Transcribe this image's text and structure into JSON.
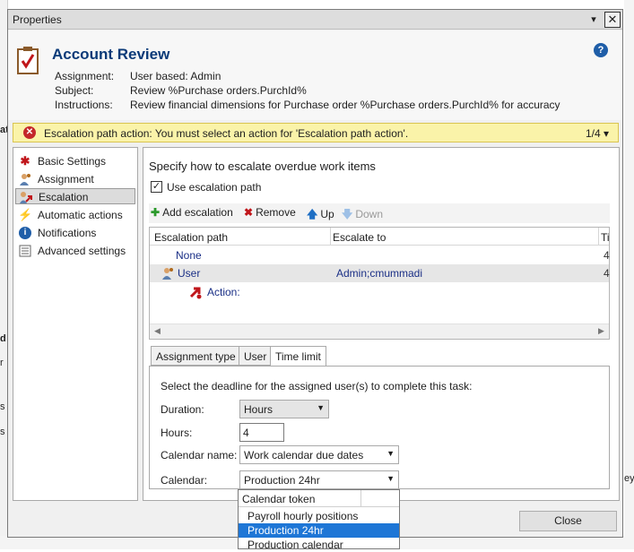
{
  "background": {
    "fragments": [
      "at",
      "d",
      "r",
      "s",
      "s",
      "ey"
    ]
  },
  "dialog": {
    "window_title": "Properties",
    "minimize_glyph": "▾",
    "close_glyph": "✕",
    "heading": "Account Review",
    "help_glyph": "?",
    "meta": [
      {
        "label": "Assignment:",
        "value": "User based: Admin"
      },
      {
        "label": "Subject:",
        "value": "Review %Purchase orders.PurchId%"
      },
      {
        "label": "Instructions:",
        "value": "Review financial dimensions for Purchase order %Purchase orders.PurchId% for accuracy"
      }
    ],
    "alert": {
      "text": "Escalation path action: You must select an action for 'Escalation path action'.",
      "count": "1/4 ▾"
    },
    "nav": [
      {
        "label": "Basic Settings",
        "icon": "asterisk-icon",
        "glyph": "✱",
        "color": "#c0161b"
      },
      {
        "label": "Assignment",
        "icon": "user-assign-icon",
        "glyph": "👤",
        "color": "#b06a1c"
      },
      {
        "label": "Escalation",
        "icon": "escalation-icon",
        "glyph": "↗",
        "color": "#c0161b"
      },
      {
        "label": "Automatic actions",
        "icon": "lightning-icon",
        "glyph": "⚡",
        "color": "#e0a800"
      },
      {
        "label": "Notifications",
        "icon": "info-icon",
        "glyph": "ℹ",
        "color": "#1f5ea8"
      },
      {
        "label": "Advanced settings",
        "icon": "settings-list-icon",
        "glyph": "☰",
        "color": "#555555"
      }
    ],
    "content": {
      "heading": "Specify how to escalate overdue work items",
      "use_escalation_label": "Use escalation path",
      "use_escalation_checked": "✓",
      "toolbar": {
        "add": "Add escalation",
        "remove": "Remove",
        "up": "Up",
        "down": "Down",
        "add_glyph": "✚",
        "remove_glyph": "✖",
        "up_glyph": "🡅",
        "down_glyph": "🡇"
      },
      "grid": {
        "col_path": "Escalation path",
        "col_escalate_to": "Escalate to",
        "col_third": "Ti",
        "rows": [
          {
            "path": "None",
            "escalate_to": "",
            "third": "4"
          },
          {
            "path": "User",
            "escalate_to": "Admin;cmummadi",
            "third": "4"
          },
          {
            "path": "Action:",
            "escalate_to": "",
            "third": ""
          }
        ]
      },
      "tabs": [
        "Assignment type",
        "User",
        "Time limit"
      ],
      "time_limit": {
        "instruction": "Select the deadline for the assigned user(s)  to complete this task:",
        "duration_label": "Duration:",
        "duration_value": "Hours",
        "hours_label": "Hours:",
        "hours_value": "4",
        "calendar_name_label": "Calendar name:",
        "calendar_name_value": "Work calendar due dates",
        "calendar_label": "Calendar:",
        "calendar_value": "Production 24hr"
      }
    },
    "close_label": "Close",
    "popup": {
      "header": "Calendar token",
      "items": [
        "Payroll hourly positions",
        "Production 24hr",
        "Production calendar"
      ],
      "selected_index": 1
    }
  }
}
